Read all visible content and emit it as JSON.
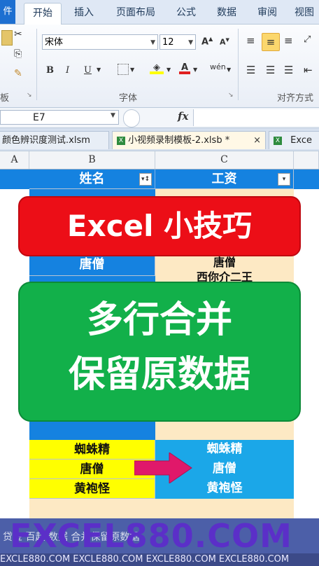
{
  "ribbon": {
    "file_tab": "件",
    "tabs": [
      "开始",
      "插入",
      "页面布局",
      "公式",
      "数据",
      "审阅",
      "视图"
    ],
    "font_name": "宋体",
    "font_size": "12",
    "clipboard_label": "板",
    "font_group_label": "字体",
    "align_group_label": "对齐方式"
  },
  "formula_bar": {
    "name_box": "E7",
    "fx": "fx"
  },
  "file_tabs": {
    "tab1": "颜色辨识度测试.xlsm",
    "tab2": "小视频录制模板-2.xlsb *",
    "tab2_close": "×",
    "tab3": "Exce"
  },
  "grid": {
    "columns": [
      "A",
      "B",
      "C"
    ],
    "header_name": "姓名",
    "header_salary": "工资",
    "row_tang_b": "唐僧",
    "row_tang_c": "唐僧",
    "row_partial_c": "西你介二王",
    "list_b": [
      "蜘蛛精",
      "唐僧",
      "黄袍怪"
    ],
    "list_c": [
      "蜘蛛精",
      "唐僧",
      "黄袍怪"
    ]
  },
  "banners": {
    "top": "Excel 小技巧",
    "middle_line1": "多行合并",
    "middle_line2": "保留原数据"
  },
  "watermark": {
    "big": "EXCEL880.COM",
    "strip": "EXCLE880.COM EXCLE880.COM EXCLE880.COM EXCLE880.COM",
    "partial_text": "贷金  百起  数据  合并保留原数据"
  },
  "colors": {
    "accent_blue": "#1582e0",
    "yellow": "#ffff00",
    "peach": "#fde9c4",
    "red_banner": "#ec0e17",
    "green_banner": "#12b04a",
    "arrow": "#e0186a"
  }
}
